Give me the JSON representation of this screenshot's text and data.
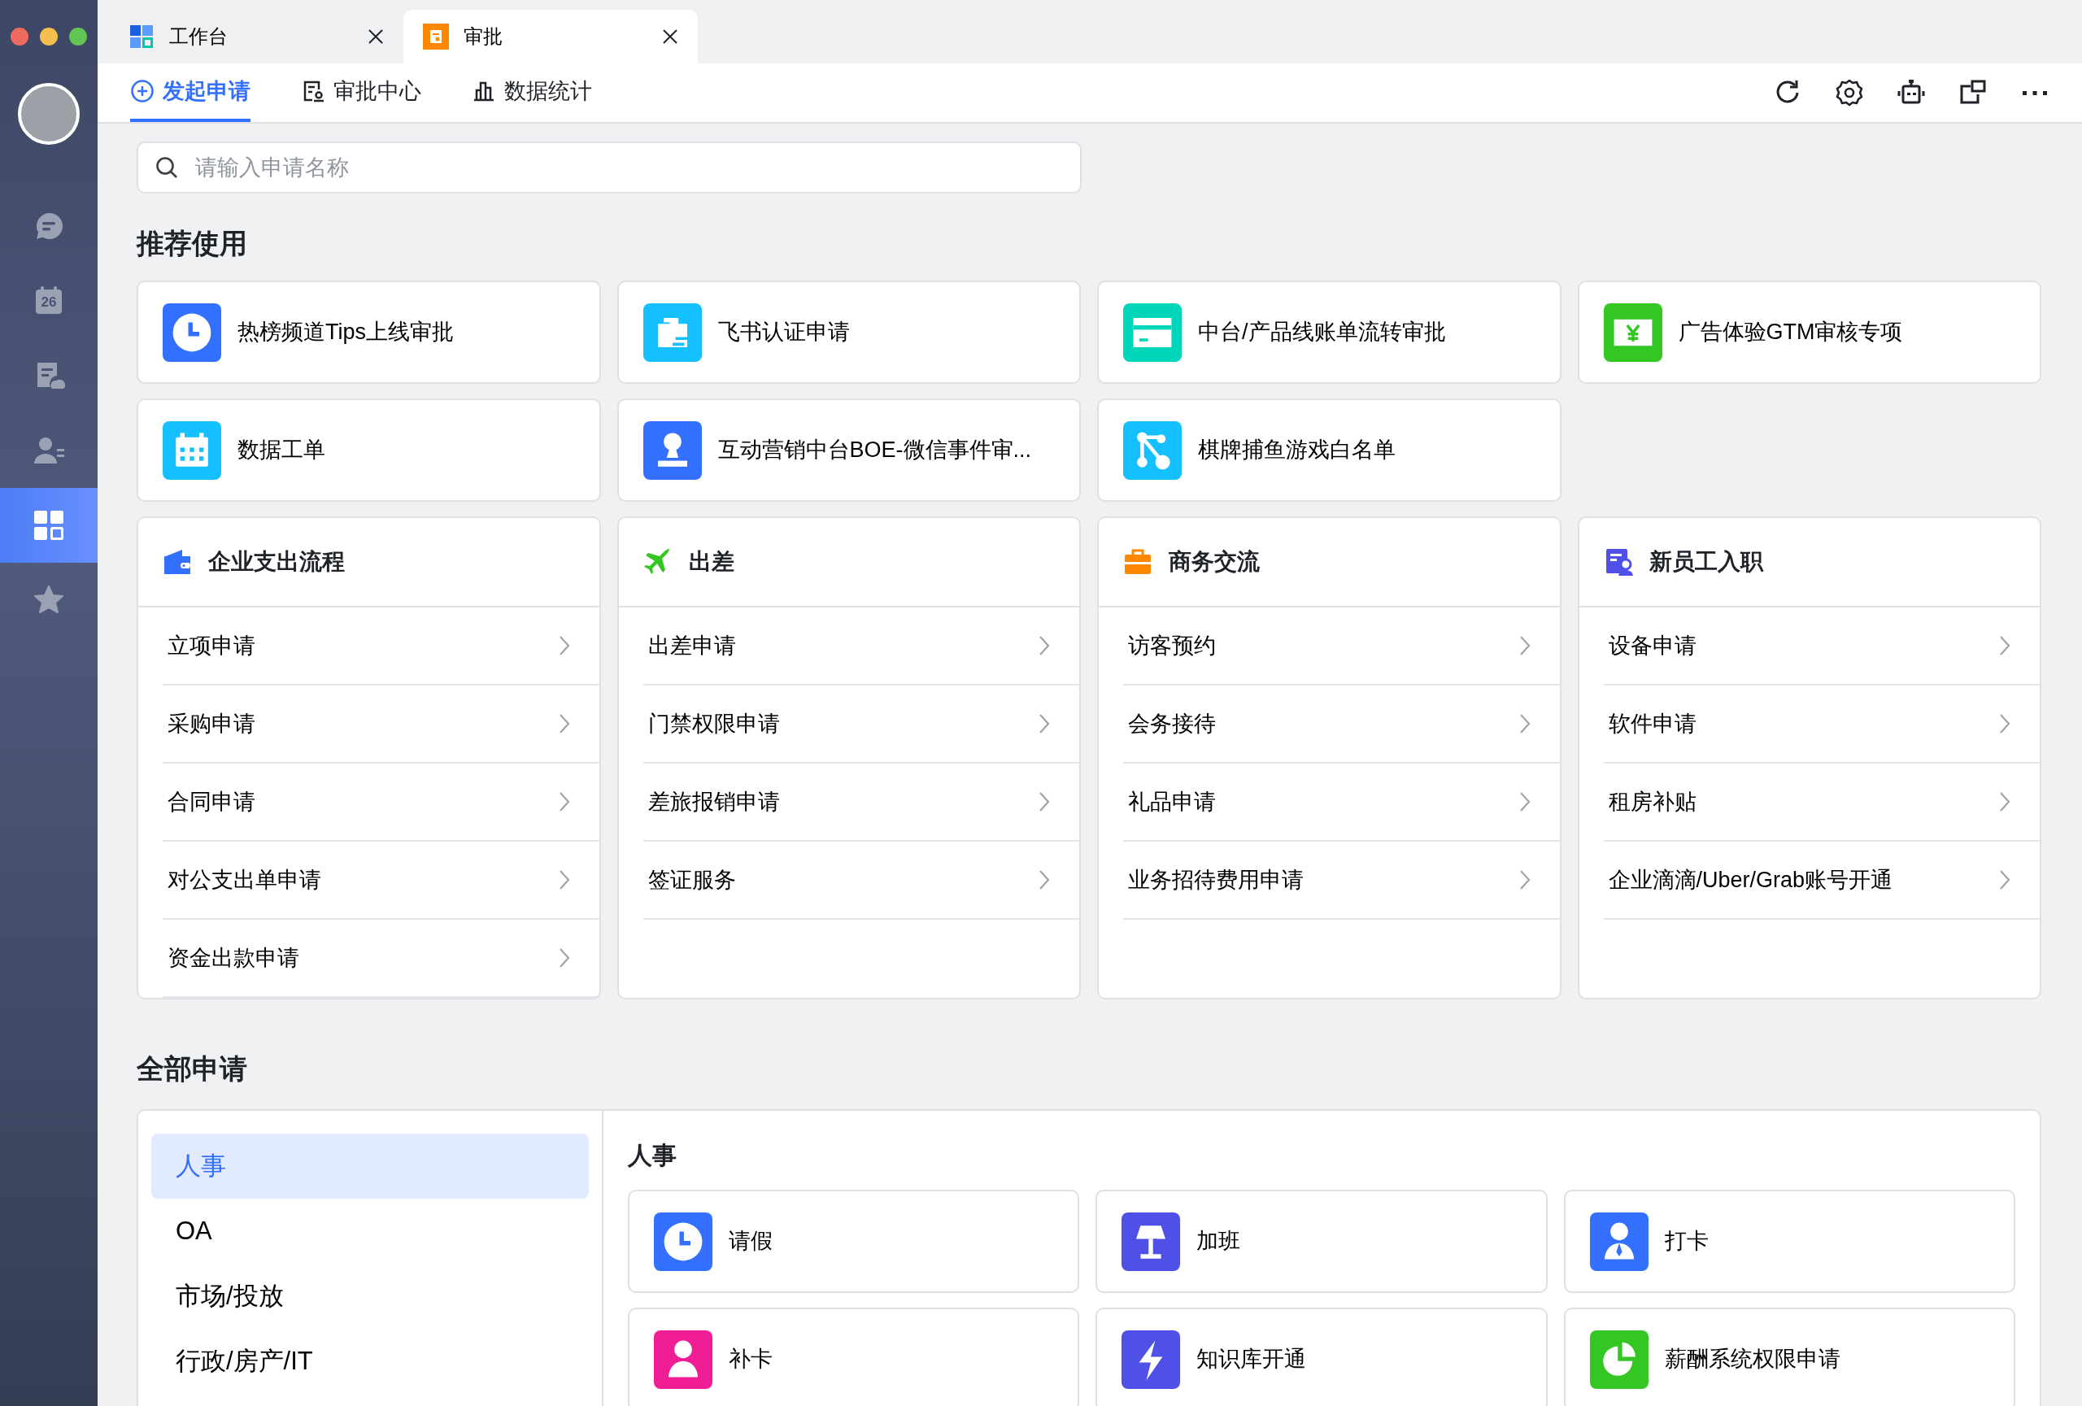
{
  "window_controls": [
    {
      "color": "#ed6a5e"
    },
    {
      "color": "#f5bf4f"
    },
    {
      "color": "#61c554"
    }
  ],
  "sidebar": {
    "items": [
      {
        "kind": "chat",
        "selected": false
      },
      {
        "kind": "calendar",
        "text": "26",
        "selected": false
      },
      {
        "kind": "docs",
        "selected": false
      },
      {
        "kind": "contacts",
        "selected": false
      },
      {
        "kind": "apps",
        "selected": true
      },
      {
        "kind": "favorites",
        "selected": false
      }
    ]
  },
  "tabs": [
    {
      "label": "工作台",
      "kind": "workspace",
      "selected": false
    },
    {
      "label": "审批",
      "kind": "approval",
      "selected": true
    }
  ],
  "nav_tabs": [
    {
      "label": "发起申请",
      "kind": "plus",
      "selected": true
    },
    {
      "label": "审批中心",
      "kind": "approval",
      "selected": false
    },
    {
      "label": "数据统计",
      "kind": "chart",
      "selected": false
    }
  ],
  "toolbar": [
    {
      "kind": "refresh"
    },
    {
      "kind": "settings"
    },
    {
      "kind": "robot"
    },
    {
      "kind": "window"
    },
    {
      "kind": "more"
    }
  ],
  "search": {
    "placeholder": "请输入申请名称"
  },
  "recommended": {
    "title": "推荐使用",
    "items": [
      {
        "label": "热榜频道Tips上线审批",
        "kind": "clock",
        "color": "#3370ff"
      },
      {
        "label": "飞书认证申请",
        "kind": "briefcase",
        "color": "#14c0ff"
      },
      {
        "label": "中台/产品线账单流转审批",
        "kind": "card",
        "color": "#00d6b9"
      },
      {
        "label": "广告体验GTM审核专项",
        "kind": "money",
        "color": "#34c724"
      },
      {
        "label": "数据工单",
        "kind": "calendar",
        "color": "#14c0ff"
      },
      {
        "label": "互动营销中台BOE-微信事件审...",
        "kind": "stamp",
        "color": "#3370ff"
      },
      {
        "label": "棋牌捕鱼游戏白名单",
        "kind": "nodes",
        "color": "#14c0ff"
      }
    ]
  },
  "categories": [
    {
      "title": "企业支出流程",
      "kind": "wallet",
      "items": [
        "立项申请",
        "采购申请",
        "合同申请",
        "对公支出单申请",
        "资金出款申请"
      ]
    },
    {
      "title": "出差",
      "kind": "plane",
      "items": [
        "出差申请",
        "门禁权限申请",
        "差旅报销申请",
        "签证服务"
      ]
    },
    {
      "title": "商务交流",
      "kind": "case",
      "items": [
        "访客预约",
        "会务接待",
        "礼品申请",
        "业务招待费用申请"
      ]
    },
    {
      "title": "新员工入职",
      "kind": "badge",
      "items": [
        "设备申请",
        "软件申请",
        "租房补贴",
        "企业滴滴/Uber/Grab账号开通"
      ]
    }
  ],
  "all": {
    "title": "全部申请",
    "groups": [
      {
        "label": "人事",
        "selected": true
      },
      {
        "label": "OA",
        "selected": false
      },
      {
        "label": "市场/投放",
        "selected": false
      },
      {
        "label": "行政/房产/IT",
        "selected": false
      }
    ],
    "section_title": "人事",
    "items": [
      {
        "label": "请假",
        "kind": "clock",
        "color": "#3370ff"
      },
      {
        "label": "加班",
        "kind": "lamp",
        "color": "#4e50e6"
      },
      {
        "label": "打卡",
        "kind": "tie",
        "color": "#3370ff"
      },
      {
        "label": "补卡",
        "kind": "person",
        "color": "#f01d94"
      },
      {
        "label": "知识库开通",
        "kind": "bolt",
        "color": "#4e50e6"
      },
      {
        "label": "薪酬系统权限申请",
        "kind": "pie",
        "color": "#34c724"
      }
    ]
  }
}
